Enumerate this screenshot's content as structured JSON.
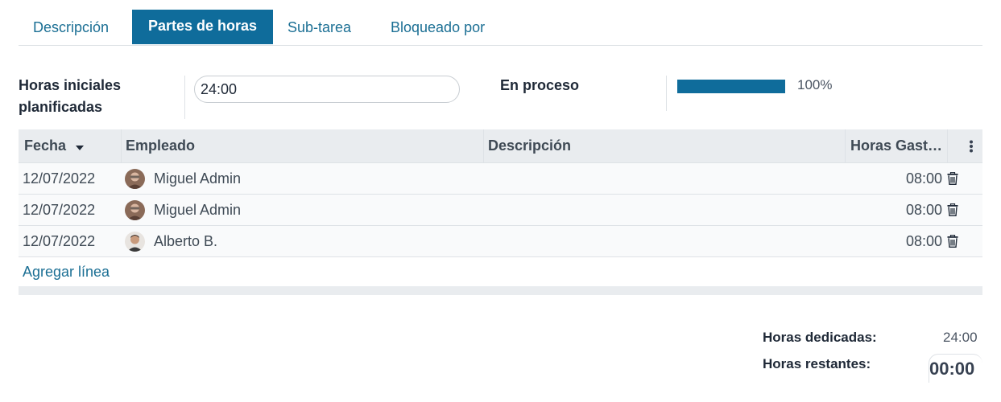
{
  "tabs": [
    {
      "label": "Descripción"
    },
    {
      "label": "Partes de horas"
    },
    {
      "label": "Sub-tarea"
    },
    {
      "label": "Bloqueado por"
    }
  ],
  "form": {
    "planned_label_line1": "Horas iniciales",
    "planned_label_line2": "planificadas",
    "planned_value": "24:00",
    "progress_label": "En proceso",
    "progress_percent": 100,
    "progress_text": "100%",
    "progress_color": "#0f6c9b"
  },
  "table": {
    "columns": [
      "Fecha",
      "Empleado",
      "Descripción",
      "Horas Gast…"
    ],
    "sort_icon": "caret-down-icon",
    "options_icon": "kebab-vertical-icon",
    "rows": [
      {
        "date": "12/07/2022",
        "employee": "Miguel Admin",
        "description": "",
        "hours": "08:00"
      },
      {
        "date": "12/07/2022",
        "employee": "Miguel Admin",
        "description": "",
        "hours": "08:00"
      },
      {
        "date": "12/07/2022",
        "employee": "Alberto B.",
        "description": "",
        "hours": "08:00"
      }
    ],
    "add_line": "Agregar línea"
  },
  "totals": {
    "spent_label": "Horas dedicadas:",
    "spent_value": "24:00",
    "remaining_label": "Horas restantes:",
    "remaining_value": "00:00"
  }
}
